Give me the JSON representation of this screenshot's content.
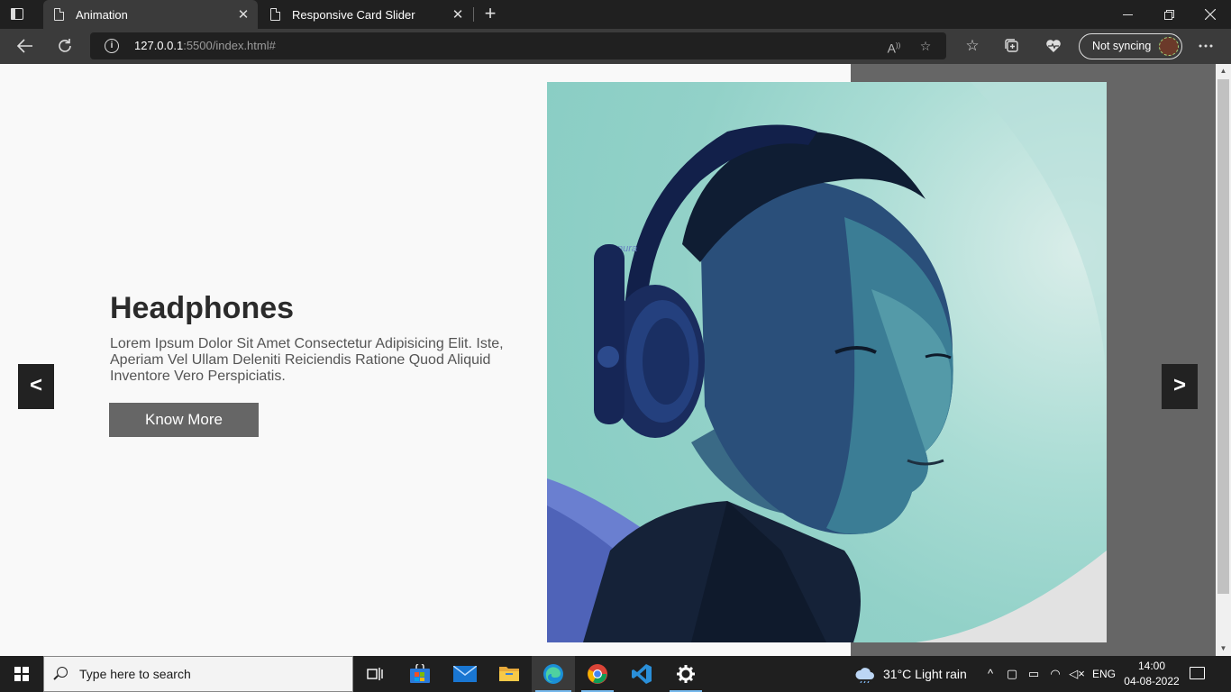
{
  "browser": {
    "tabs": [
      {
        "title": "Animation",
        "active": true
      },
      {
        "title": "Responsive Card Slider",
        "active": false
      }
    ],
    "address": {
      "host": "127.0.0.1",
      "rest": ":5500/index.html#"
    },
    "profile_status": "Not syncing",
    "icons": {
      "tab_actions": "tab-actions-icon",
      "new_tab": "plus-icon",
      "minimize": "minimize-icon",
      "restore": "restore-icon",
      "close": "close-icon",
      "back": "back-arrow-icon",
      "refresh": "refresh-icon",
      "site_info": "info-icon",
      "read_aloud": "read-aloud-icon",
      "add_favorite": "add-favorite-icon",
      "favorites": "favorites-icon",
      "collections": "collections-icon",
      "performance": "heartbeat-icon",
      "more": "more-dots-icon"
    }
  },
  "page": {
    "title": "Headphones",
    "description": "Lorem Ipsum Dolor Sit Amet Consectetur Adipisicing Elit. Iste, Aperiam Vel Ullam Deleniti Reiciendis Ratione Quod Aliquid Inventore Vero Perspiciatis.",
    "button_label": "Know More",
    "prev_label": "<",
    "next_label": ">",
    "image_brand_text": "nura",
    "colors": {
      "panel": "#666666",
      "button": "#666666",
      "arrow_bg": "#222222"
    }
  },
  "taskbar": {
    "search_placeholder": "Type here to search",
    "weather": "31°C  Light rain",
    "language": "ENG",
    "time": "14:00",
    "date": "04-08-2022",
    "apps": [
      "task-view",
      "microsoft-store",
      "mail",
      "file-explorer",
      "edge",
      "chrome",
      "vscode",
      "settings"
    ]
  }
}
